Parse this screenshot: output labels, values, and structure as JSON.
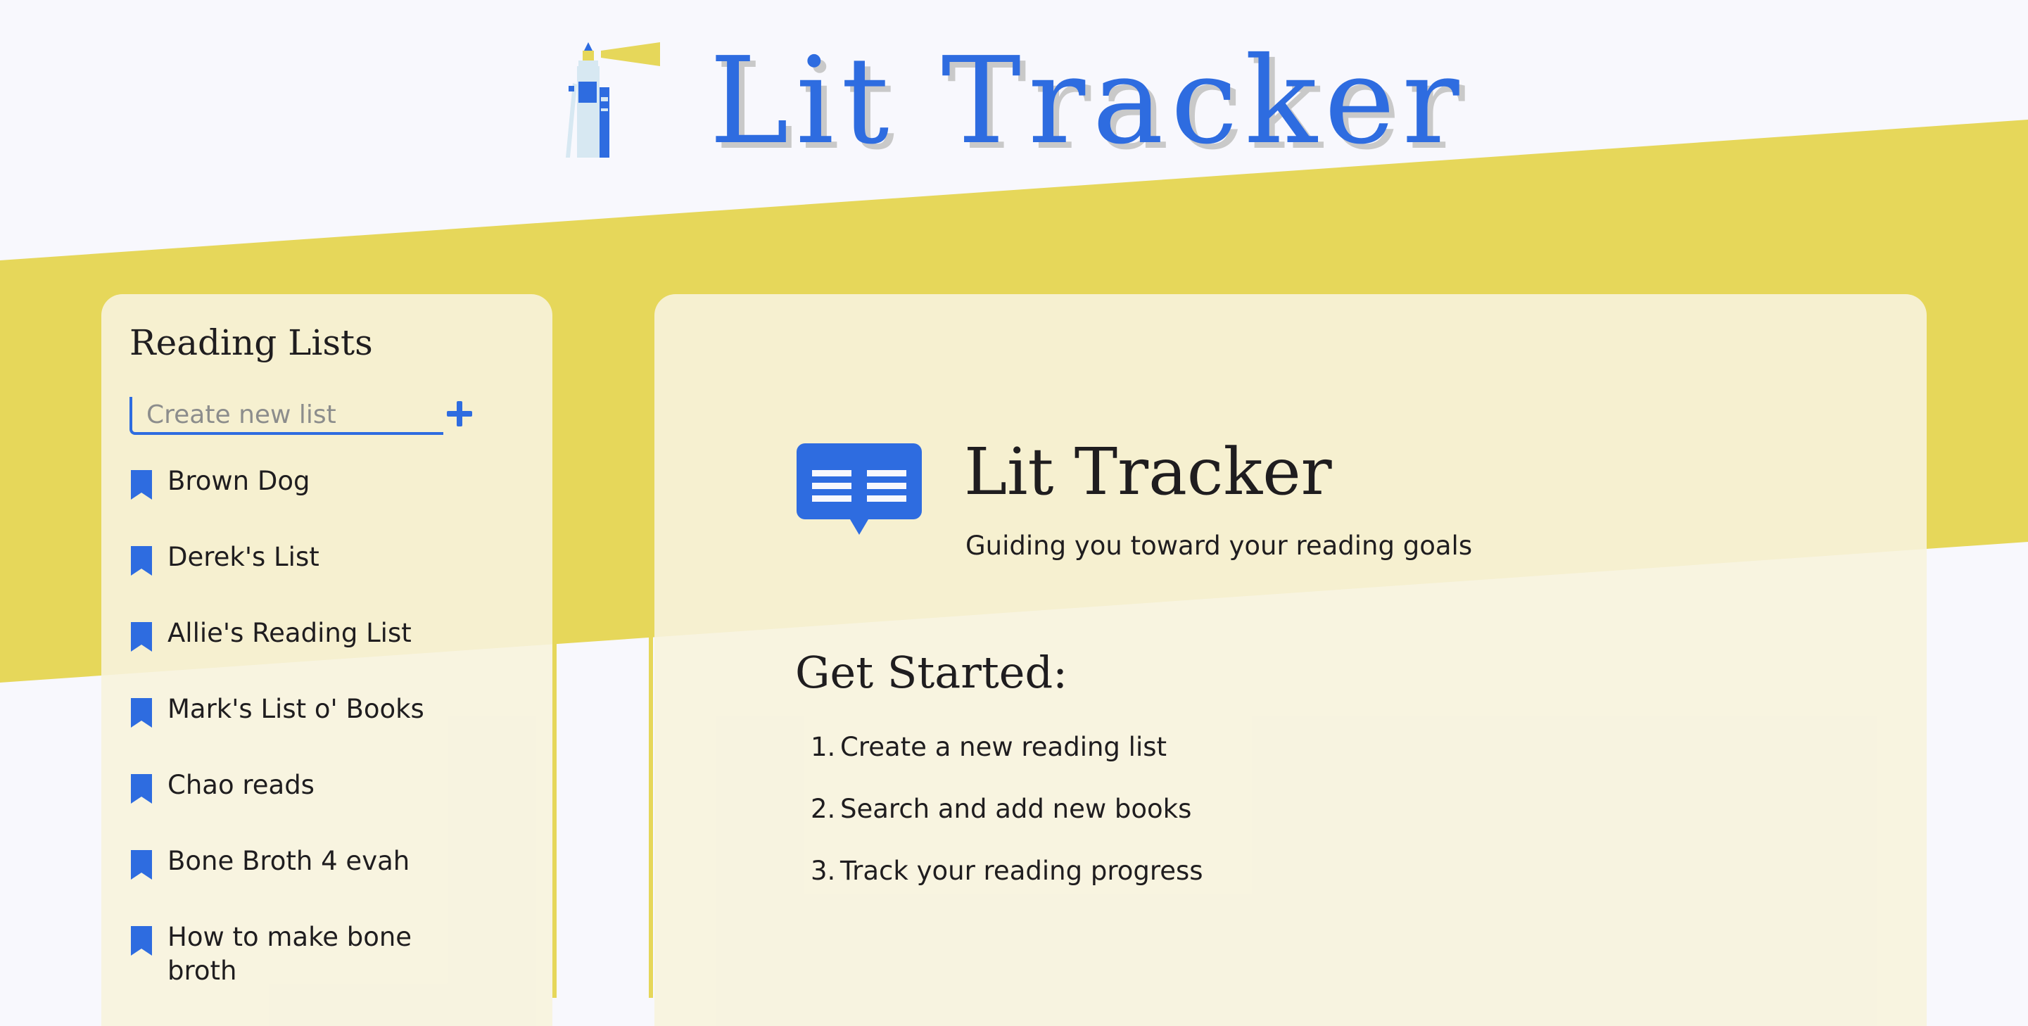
{
  "header": {
    "app_title": "Lit Tracker"
  },
  "sidebar": {
    "title": "Reading Lists",
    "new_list_placeholder": "Create new list",
    "add_button_label": "+",
    "lists": [
      {
        "label": "Brown Dog"
      },
      {
        "label": "Derek's List"
      },
      {
        "label": "Allie's Reading List"
      },
      {
        "label": "Mark's List o' Books"
      },
      {
        "label": "Chao reads"
      },
      {
        "label": "Bone Broth 4 evah"
      },
      {
        "label": "How to make bone broth"
      }
    ]
  },
  "main": {
    "hero_title": "Lit Tracker",
    "hero_subtitle": "Guiding you toward your reading goals",
    "get_started_title": "Get Started:",
    "steps": [
      {
        "num": "1.",
        "text": "Create a new reading list"
      },
      {
        "num": "2.",
        "text": "Search and add new books"
      },
      {
        "num": "3.",
        "text": "Track your reading progress"
      }
    ]
  },
  "colors": {
    "accent": "#2e6ce0",
    "band": "#e6d75a",
    "panel": "#f7f3dd",
    "background": "#f8f8fd",
    "text": "#1f1d1f"
  },
  "icons": {
    "logo": "lighthouse-books-icon",
    "list_item": "bookmark-icon",
    "hero": "open-book-icon",
    "add": "plus-icon"
  }
}
